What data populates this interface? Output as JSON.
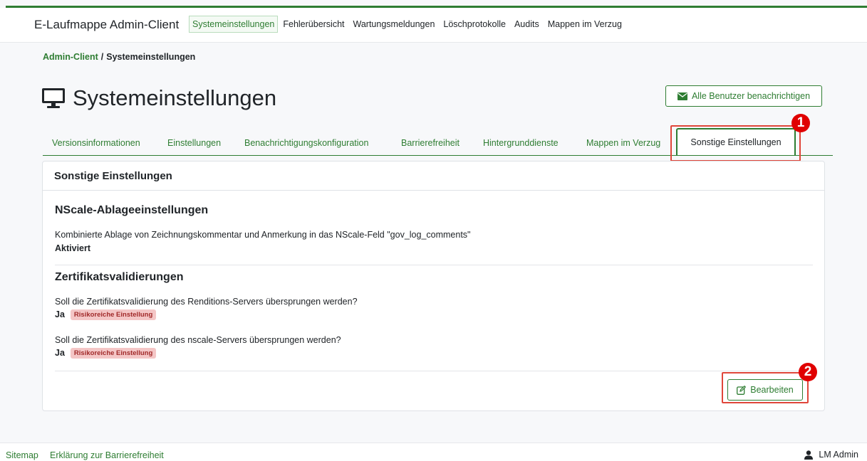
{
  "navbar": {
    "brand": "E-Laufmappe Admin-Client",
    "links": [
      {
        "label": "Systemeinstellungen",
        "active": true
      },
      {
        "label": "Fehlerübersicht",
        "active": false
      },
      {
        "label": "Wartungsmeldungen",
        "active": false
      },
      {
        "label": "Löschprotokolle",
        "active": false
      },
      {
        "label": "Audits",
        "active": false
      },
      {
        "label": "Mappen im Verzug",
        "active": false
      }
    ]
  },
  "breadcrumb": {
    "root": "Admin-Client",
    "separator": "/",
    "current": "Systemeinstellungen"
  },
  "page": {
    "title": "Systemeinstellungen",
    "title_icon": "monitor-icon",
    "notify_button": "Alle Benutzer benachrichtigen",
    "notify_icon": "envelope-icon"
  },
  "tabs": [
    {
      "label": "Versionsinformationen",
      "active": false
    },
    {
      "label": "Einstellungen",
      "active": false
    },
    {
      "label": "Benachrichtigungskonfiguration",
      "active": false
    },
    {
      "label": "Barrierefreiheit",
      "active": false
    },
    {
      "label": "Hintergrunddienste",
      "active": false
    },
    {
      "label": "Mappen im Verzug",
      "active": false
    },
    {
      "label": "Sonstige Einstellungen",
      "active": true
    }
  ],
  "annotations": {
    "marker1": "1",
    "marker2": "2"
  },
  "card": {
    "header": "Sonstige Einstellungen",
    "nscale": {
      "title": "NScale-Ablageeinstellungen",
      "setting_text": "Kombinierte Ablage von Zeichnungskommentar und Anmerkung in das NScale-Feld \"gov_log_comments\"",
      "setting_value": "Aktiviert"
    },
    "certs": {
      "title": "Zertifikatsvalidierungen",
      "q1": "Soll die Zertifikatsvalidierung des Renditions-Servers übersprungen werden?",
      "a1": "Ja",
      "badge1": "Risikoreiche Einstellung",
      "q2": "Soll die Zertifikatsvalidierung des nscale-Servers übersprungen werden?",
      "a2": "Ja",
      "badge2": "Risikoreiche Einstellung"
    },
    "edit_button": "Bearbeiten",
    "edit_icon": "edit-icon"
  },
  "footer": {
    "sitemap": "Sitemap",
    "accessibility": "Erklärung zur Barrierefreiheit",
    "user": "LM Admin",
    "user_icon": "user-icon"
  },
  "colors": {
    "accent": "#2e7d32",
    "highlight": "#e0463a",
    "marker": "#e00000",
    "badge_bg": "#f4c6c6",
    "badge_text": "#a12a2a"
  }
}
